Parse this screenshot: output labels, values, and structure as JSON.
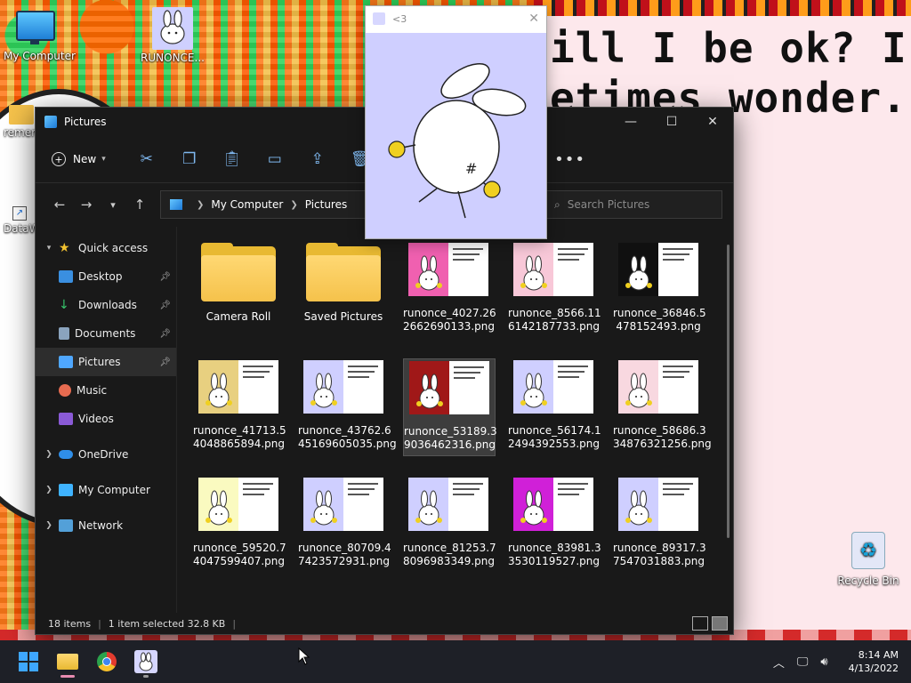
{
  "desktop": {
    "wallpaper_text_line1": "ill I be ok? I",
    "wallpaper_text_line2": "etimes wonder...",
    "icons": [
      {
        "label": "My Computer",
        "icon": "computer-icon"
      },
      {
        "label": "RUNONCE...",
        "icon": "bunny-app-icon"
      },
      {
        "label": "remem",
        "icon": "folder-icon"
      },
      {
        "label": "DataW",
        "icon": "shortcut-icon"
      },
      {
        "label": "Recycle Bin",
        "icon": "recycle-bin-icon"
      }
    ]
  },
  "popup": {
    "title": "<3",
    "close_glyph": "✕"
  },
  "explorer": {
    "title": "Pictures",
    "window_controls": {
      "minimize": "—",
      "maximize": "☐",
      "close": "✕"
    },
    "toolbar": {
      "new_label": "New",
      "more_label": "•••",
      "icons": [
        "cut-icon",
        "copy-icon",
        "paste-icon",
        "rename-icon",
        "share-icon",
        "delete-icon"
      ]
    },
    "address": {
      "crumbs": [
        "My Computer",
        "Pictures"
      ]
    },
    "search": {
      "placeholder": "Search Pictures"
    },
    "nav": {
      "quick_access": "Quick access",
      "items": [
        {
          "label": "Desktop",
          "icon": "desktop-icon",
          "color": "#3a8fe0",
          "pinned": true
        },
        {
          "label": "Downloads",
          "icon": "download-icon",
          "color": "#37c26a",
          "pinned": true
        },
        {
          "label": "Documents",
          "icon": "document-icon",
          "color": "#8aa3bd",
          "pinned": true
        },
        {
          "label": "Pictures",
          "icon": "pictures-icon",
          "color": "#4fa7ff",
          "pinned": true,
          "selected": true
        },
        {
          "label": "Music",
          "icon": "music-icon",
          "color": "#e66b50",
          "pinned": false
        },
        {
          "label": "Videos",
          "icon": "videos-icon",
          "color": "#8a5ad6",
          "pinned": false
        }
      ],
      "onedrive": "OneDrive",
      "my_computer": "My Computer",
      "network": "Network"
    },
    "files": [
      {
        "name": "Camera Roll",
        "type": "folder"
      },
      {
        "name": "Saved Pictures",
        "type": "folder"
      },
      {
        "name": "runonce_4027.26\n2662690133.png",
        "type": "image",
        "bg": "#f060b0"
      },
      {
        "name": "runonce_8566.11\n6142187733.png",
        "type": "image",
        "bg": "#f8c8d8"
      },
      {
        "name": "runonce_36846.5\n478152493.png",
        "type": "image",
        "bg": "#101010"
      },
      {
        "name": "runonce_41713.5\n4048865894.png",
        "type": "image",
        "bg": "#e8d080"
      },
      {
        "name": "runonce_43762.6\n45169605035.png",
        "type": "image",
        "bg": "#cfcfff"
      },
      {
        "name": "runonce_53189.3\n9036462316.png",
        "type": "image",
        "bg": "#a01818",
        "selected": true
      },
      {
        "name": "runonce_56174.1\n2494392553.png",
        "type": "image",
        "bg": "#cfcfff"
      },
      {
        "name": "runonce_58686.3\n34876321256.png",
        "type": "image",
        "bg": "#f8d8e0"
      },
      {
        "name": "runonce_59520.7\n4047599407.png",
        "type": "image",
        "bg": "#fafac0"
      },
      {
        "name": "runonce_80709.4\n7423572931.png",
        "type": "image",
        "bg": "#cfcfff"
      },
      {
        "name": "runonce_81253.7\n8096983349.png",
        "type": "image",
        "bg": "#cfcfff"
      },
      {
        "name": "runonce_83981.3\n3530119527.png",
        "type": "image",
        "bg": "#d020d8"
      },
      {
        "name": "runonce_89317.3\n7547031883.png",
        "type": "image",
        "bg": "#cfcfff"
      }
    ],
    "status": {
      "count": "18 items",
      "selection": "1 item selected  32.8 KB"
    }
  },
  "taskbar": {
    "time": "8:14 AM",
    "date": "4/13/2022",
    "apps": [
      "start-icon",
      "file-explorer-icon",
      "chrome-icon",
      "bunny-app-icon"
    ]
  }
}
